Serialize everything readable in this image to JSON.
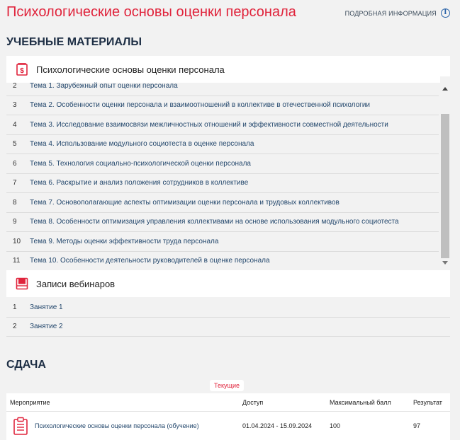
{
  "header": {
    "title": "Психологические основы оценки персонала",
    "more_info": "ПОДРОБНАЯ ИНФОРМАЦИЯ",
    "info_glyph": "i"
  },
  "materials": {
    "heading": "УЧЕБНЫЕ МАТЕРИАЛЫ",
    "groups": [
      {
        "title": "Психологические основы оценки персонала",
        "icon": "document-dollar-icon",
        "items": [
          {
            "num": "2",
            "title": "Тема 1. Зарубежный опыт оценки персонала"
          },
          {
            "num": "3",
            "title": "Тема 2. Особенности оценки персонала и взаимоотношений в коллективе в отечественной психологии"
          },
          {
            "num": "4",
            "title": "Тема 3. Исследование взаимосвязи межличностных отношений и эффективности совместной деятельности"
          },
          {
            "num": "5",
            "title": "Тема 4. Использование модульного социотеста в оценке персонала"
          },
          {
            "num": "6",
            "title": "Тема 5. Технология социально-психологической оценки персонала"
          },
          {
            "num": "7",
            "title": "Тема 6. Раскрытие и анализ положения сотрудников в коллективе"
          },
          {
            "num": "8",
            "title": "Тема 7. Основополагающие аспекты оптимизации оценки персонала и трудовых коллективов"
          },
          {
            "num": "9",
            "title": "Тема 8. Особенности оптимизация управления коллективами на основе использования модульного социотеста"
          },
          {
            "num": "10",
            "title": "Тема 9. Методы оценки эффективности труда персонала"
          },
          {
            "num": "11",
            "title": "Тема 10. Особенности деятельности руководителей в оценке персонала"
          }
        ]
      },
      {
        "title": "Записи вебинаров",
        "icon": "video-folder-icon",
        "items": [
          {
            "num": "1",
            "title": "Занятие 1"
          },
          {
            "num": "2",
            "title": "Занятие 2"
          }
        ]
      }
    ]
  },
  "exams": {
    "heading": "СДАЧА",
    "tab_current": "Текущие",
    "columns": {
      "event": "Мероприятие",
      "access": "Доступ",
      "max_score": "Максимальный балл",
      "result": "Результат"
    },
    "rows": [
      {
        "event": "Психологические основы оценки персонала (обучение)",
        "access": "01.04.2024 - 15.09.2024",
        "max_score": "100",
        "result": "97"
      }
    ]
  },
  "colors": {
    "accent": "#e0243c",
    "heading": "#1e2f45",
    "link": "#23476c",
    "background": "#f2f2f2"
  }
}
